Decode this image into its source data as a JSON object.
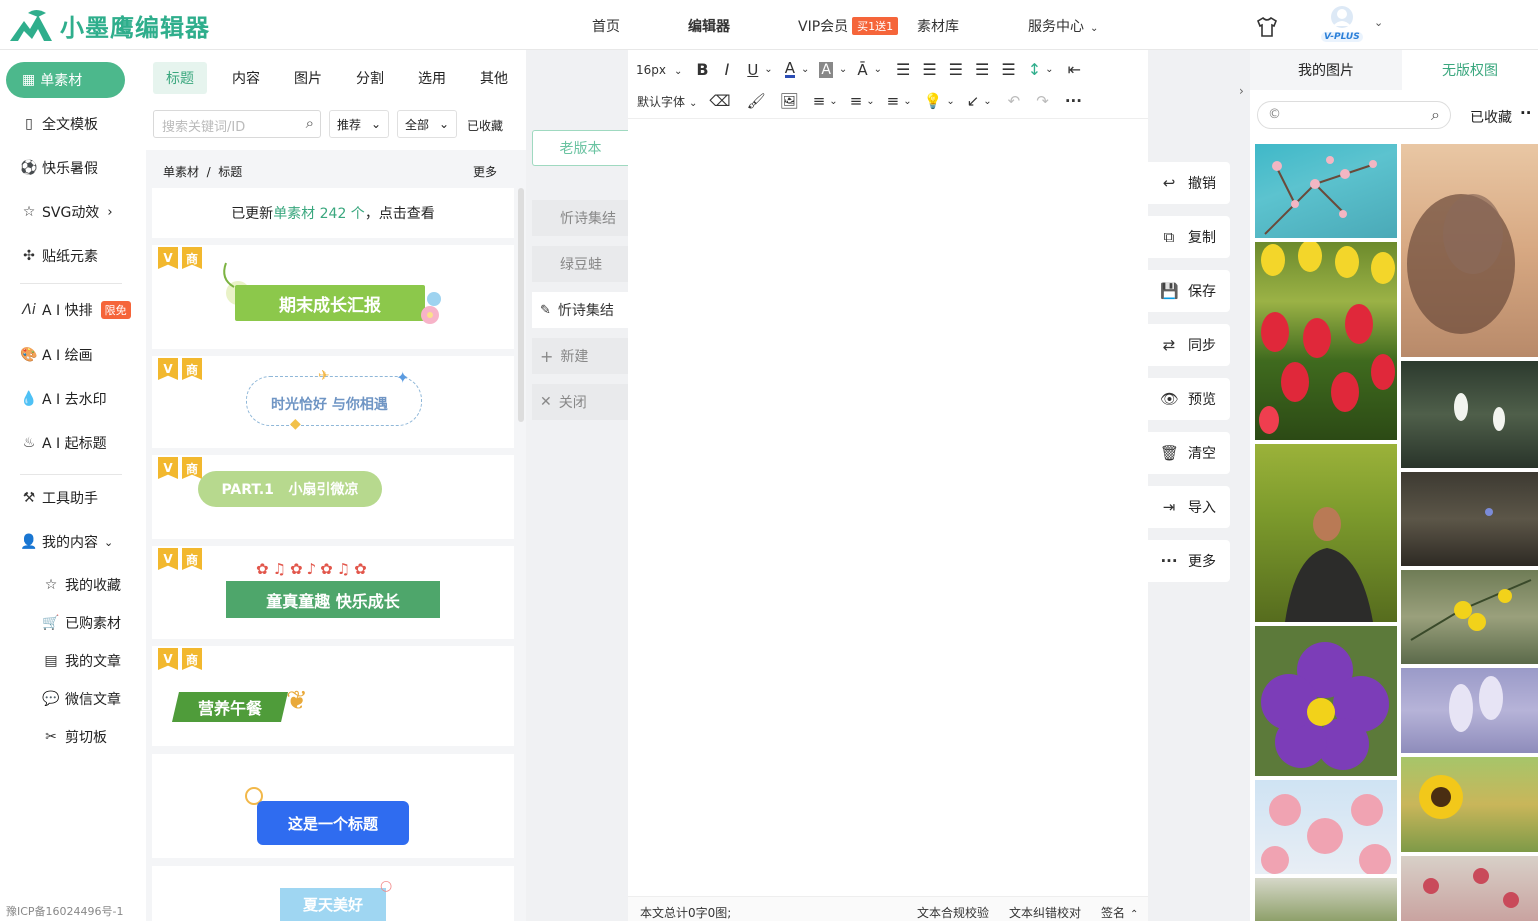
{
  "brand": {
    "name": "小墨鹰编辑器"
  },
  "nav": {
    "home": "首页",
    "editor": "编辑器",
    "vip": "VIP会员",
    "vip_badge": "买1送1",
    "library": "素材库",
    "service": "服务中心"
  },
  "user": {
    "badge": "V-PLUS"
  },
  "sidebar": {
    "active": "单素材",
    "items": {
      "full_template": "全文模板",
      "summer": "快乐暑假",
      "svg": "SVG动效",
      "sticker": "贴纸元素",
      "ai_layout": "A I 快排",
      "ai_layout_badge": "限免",
      "ai_draw": "A I 绘画",
      "ai_watermark": "A I 去水印",
      "ai_title": "A I 起标题",
      "tools": "工具助手",
      "my_content": "我的内容"
    },
    "sub": {
      "favorites": "我的收藏",
      "purchased": "已购素材",
      "articles": "我的文章",
      "wechat": "微信文章",
      "clipboard": "剪切板"
    },
    "icp": "豫ICP备16024496号-1"
  },
  "panel": {
    "tabs": [
      "标题",
      "内容",
      "图片",
      "分割",
      "选用",
      "其他"
    ],
    "search_placeholder": "搜索关键词/ID",
    "filter_recommend": "推荐",
    "filter_all": "全部",
    "collected": "已收藏",
    "crumb": "单素材  /  标题",
    "more": "更多",
    "notice_prefix": "已更新",
    "notice_link": "单素材 242 个",
    "notice_suffix": "，点击查看",
    "tag_shang": "商",
    "cards": {
      "c1": "期末成长汇报",
      "c2": "时光恰好 与你相遇",
      "c3": "PART.1   小扇引微凉",
      "c4": "童真童趣 快乐成长",
      "c5": "营养午餐",
      "c6": "这是一个标题",
      "c7": "夏天美好"
    }
  },
  "versions": {
    "old": "老版本",
    "items": [
      "忻诗集结",
      "绿豆蛙",
      "忻诗集结"
    ],
    "new": "新建",
    "close": "关闭"
  },
  "toolbar": {
    "font_size": "16px",
    "font_family": "默认字体"
  },
  "status": {
    "count": "本文总计0字0图;",
    "compliance": "文本合规校验",
    "proofread": "文本纠错校对",
    "signature": "签名"
  },
  "actions": [
    "撤销",
    "复制",
    "保存",
    "同步",
    "预览",
    "清空",
    "导入",
    "更多"
  ],
  "right": {
    "tab_mine": "我的图片",
    "tab_free": "无版权图",
    "collected": "已收藏"
  },
  "colors": {
    "brand": "#2fae8c",
    "accent": "#4cb88c",
    "badge": "#f5653a",
    "tag": "#f2b82e"
  }
}
